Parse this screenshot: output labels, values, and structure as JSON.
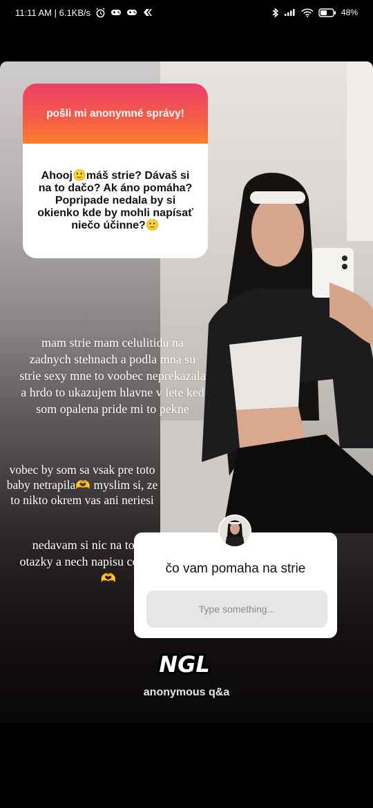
{
  "status_bar": {
    "time_speed": "11:11 AM | 6.1KB/s",
    "battery": "48%"
  },
  "question_card": {
    "header": "pošli mi anonymné správy!",
    "question": "Ahooj🙂máš strie? Dávaš si na to dačo? Ak áno pomáha? Popripade nedala by si okienko kde by mohli napísať niečo účinne?🙂"
  },
  "overlay_text": {
    "paragraph_1": "mam strie mam celulitidu na zadnych stehnach a podla mna su strie sexy mne to voobec neprekazala a hrdo to ukazujem hlavne v lete ked som opalena pride mi to pekne",
    "paragraph_2": "vobec by som sa vsak pre toto baby netrapila🫶 myslim si, ze to nikto okrem vas ani neriesi",
    "paragraph_3": "nedavam si nic na to no dam ti otazky a nech napisu co im pomaha🫶"
  },
  "answer_card": {
    "question": "čo vam pomaha na strie",
    "input_placeholder": "Type something..."
  },
  "footer": {
    "logo_text": "NGL",
    "subtitle": "anonymous q&a"
  }
}
